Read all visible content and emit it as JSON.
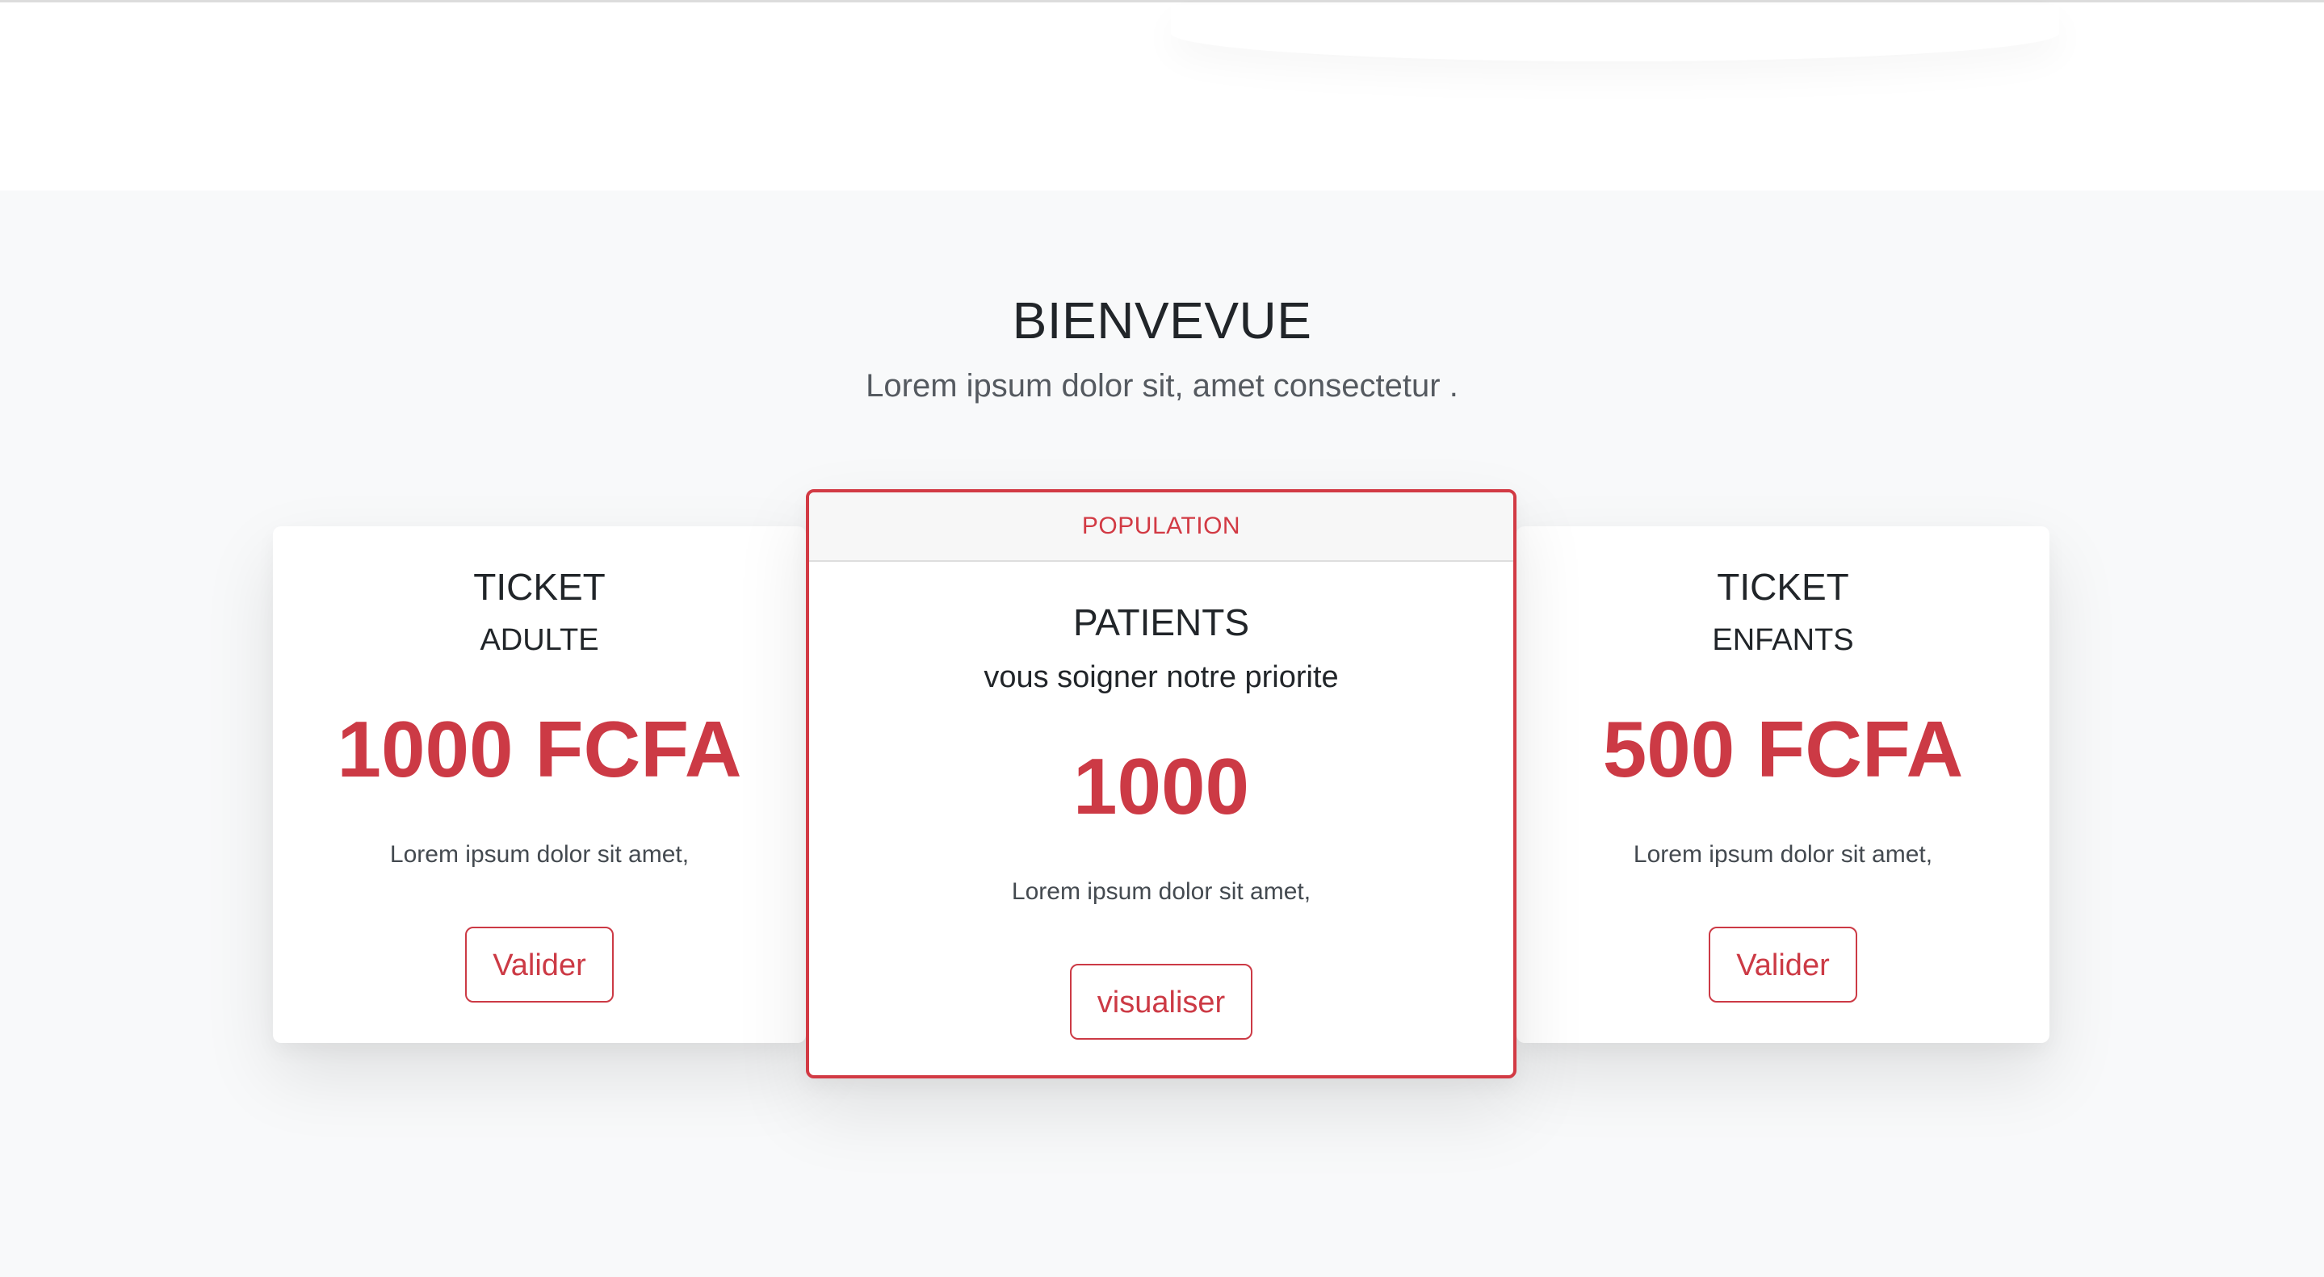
{
  "header": {},
  "hero": {
    "title": "BIENVEVUE",
    "subtitle": "Lorem ipsum dolor sit, amet consectetur ."
  },
  "colors": {
    "accent": "#cc3a45",
    "section_background": "#f8f9fa",
    "card_background": "#ffffff"
  },
  "cards": [
    {
      "title": "TICKET",
      "subtitle": "ADULTE",
      "price": "1000 FCFA",
      "description": "Lorem ipsum dolor sit amet,",
      "button_label": "Valider"
    },
    {
      "header_label": "POPULATION",
      "title": "PATIENTS",
      "subtitle": "vous soigner notre priorite",
      "price": "1000",
      "description": "Lorem ipsum dolor sit amet,",
      "button_label": "visualiser"
    },
    {
      "title": "TICKET",
      "subtitle": "ENFANTS",
      "price": "500 FCFA",
      "description": "Lorem ipsum dolor sit amet,",
      "button_label": "Valider"
    }
  ]
}
